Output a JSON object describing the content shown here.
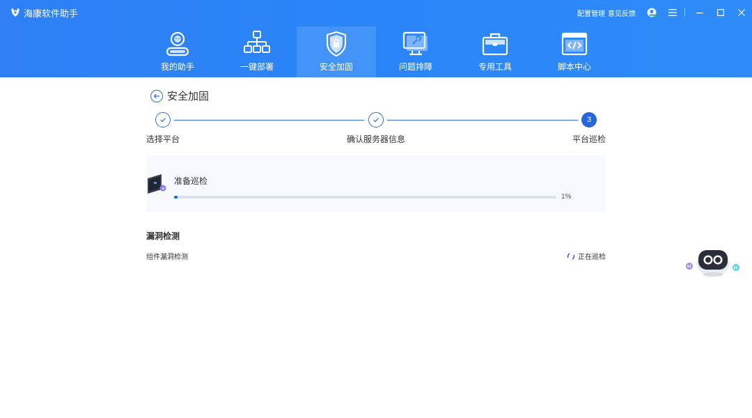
{
  "app": {
    "title": "海康软件助手"
  },
  "top_links": {
    "config": "配置管理",
    "feedback": "意见反馈"
  },
  "nav": [
    {
      "label": "我的助手",
      "icon": "assistant-icon"
    },
    {
      "label": "一键部署",
      "icon": "deploy-tree-icon"
    },
    {
      "label": "安全加固",
      "icon": "shield-lock-icon",
      "active": true
    },
    {
      "label": "问题排障",
      "icon": "monitor-wrench-icon"
    },
    {
      "label": "专用工具",
      "icon": "toolbox-icon"
    },
    {
      "label": "脚本中心",
      "icon": "code-window-icon"
    }
  ],
  "page": {
    "title": "安全加固"
  },
  "steps": [
    {
      "label": "选择平台",
      "state": "done"
    },
    {
      "label": "确认服务器信息",
      "state": "done"
    },
    {
      "label": "平台巡检",
      "state": "current",
      "number": "3"
    }
  ],
  "inspection": {
    "title": "准备巡检",
    "progress": 1,
    "progress_text": "1%"
  },
  "section": {
    "title": "漏洞检测"
  },
  "rows": [
    {
      "label": "组件漏洞检测",
      "status": "正在巡检"
    }
  ],
  "colors": {
    "primary": "#2666d9",
    "header_start": "#2f7ff5",
    "header_end": "#2f8bf7"
  }
}
